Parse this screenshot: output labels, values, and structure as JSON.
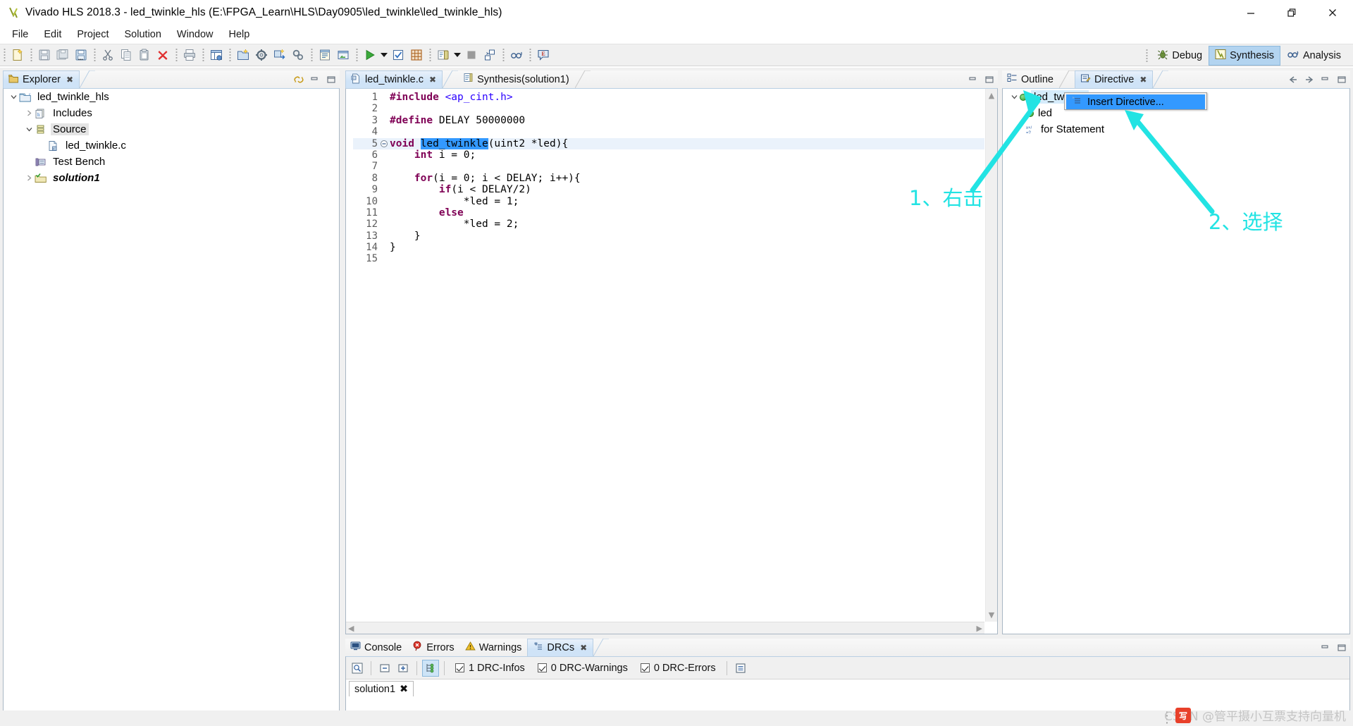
{
  "window": {
    "title": "Vivado HLS 2018.3 - led_twinkle_hls (E:\\FPGA_Learn\\HLS\\Day0905\\led_twinkle\\led_twinkle_hls)",
    "minimize": "—",
    "restore": "❐",
    "close": "✕"
  },
  "menu": {
    "items": [
      {
        "label": "File"
      },
      {
        "label": "Edit"
      },
      {
        "label": "Project"
      },
      {
        "label": "Solution"
      },
      {
        "label": "Window"
      },
      {
        "label": "Help"
      }
    ]
  },
  "toolbar": {
    "icons": [
      "new-file-icon",
      "save-icon",
      "save-all-icon",
      "save-as-icon",
      "cut-icon",
      "copy-icon",
      "paste-icon",
      "delete-icon",
      "print-icon",
      "new-project-icon",
      "new-solution-icon",
      "project-settings-icon",
      "import-icon",
      "solution-settings-icon",
      "report-icon",
      "open-window-icon",
      "run-c-simulation-icon",
      "run-synthesis-icon",
      "run-cosim-icon",
      "export-rtl-icon",
      "open-report-icon",
      "stop-icon",
      "compare-reports-icon",
      "search-icon",
      "annotate-icon"
    ],
    "perspectives": [
      {
        "label": "Debug",
        "icon": "debug-icon",
        "active": false
      },
      {
        "label": "Synthesis",
        "icon": "synthesis-icon",
        "active": true
      },
      {
        "label": "Analysis",
        "icon": "analysis-icon",
        "active": false
      }
    ]
  },
  "explorer": {
    "tab_label": "Explorer",
    "tab_icon": "explorer-icon",
    "tools": [
      "link-with-editor-icon",
      "minimize-icon",
      "maximize-icon"
    ],
    "tree": [
      {
        "label": "led_twinkle_hls",
        "icon": "c-project-icon",
        "arrow": "down",
        "indent": 0,
        "selected": false,
        "style": "normal"
      },
      {
        "label": "Includes",
        "icon": "includes-icon",
        "arrow": "right",
        "indent": 1,
        "selected": false,
        "style": "normal"
      },
      {
        "label": "Source",
        "icon": "source-folder-icon",
        "arrow": "down",
        "indent": 1,
        "selected": true,
        "style": "normal"
      },
      {
        "label": "led_twinkle.c",
        "icon": "c-file-icon",
        "arrow": "none",
        "indent": 2,
        "selected": false,
        "style": "normal"
      },
      {
        "label": "Test Bench",
        "icon": "test-bench-icon",
        "arrow": "none",
        "indent": 1,
        "selected": false,
        "style": "normal"
      },
      {
        "label": "solution1",
        "icon": "solution-folder-icon",
        "arrow": "right",
        "indent": 1,
        "selected": false,
        "style": "bolditalic"
      }
    ]
  },
  "editor": {
    "tabs": [
      {
        "label": "led_twinkle.c",
        "icon": "c-file-icon",
        "active": true,
        "closable": true
      },
      {
        "label": "Synthesis(solution1)",
        "icon": "synthesis-report-icon",
        "active": false,
        "closable": false
      }
    ],
    "tools": [
      "minimize-icon",
      "maximize-icon"
    ],
    "lines": [
      {
        "n": "1",
        "tokens": [
          {
            "t": "#include ",
            "c": "pp"
          },
          {
            "t": "<ap_cint.h>",
            "c": "hdr"
          }
        ],
        "fold": "none",
        "highlight": false
      },
      {
        "n": "2",
        "tokens": [],
        "fold": "none",
        "highlight": false
      },
      {
        "n": "3",
        "tokens": [
          {
            "t": "#define ",
            "c": "pp"
          },
          {
            "t": "DELAY 50000000",
            "c": "plain"
          }
        ],
        "fold": "none",
        "highlight": false
      },
      {
        "n": "4",
        "tokens": [],
        "fold": "none",
        "highlight": false
      },
      {
        "n": "5",
        "tokens": [
          {
            "t": "void ",
            "c": "kw"
          },
          {
            "t": "led_twinkle",
            "c": "sel-tok"
          },
          {
            "t": "(uint2 *led){",
            "c": "plain"
          }
        ],
        "fold": "collapse",
        "highlight": true
      },
      {
        "n": "6",
        "tokens": [
          {
            "t": "    ",
            "c": "plain"
          },
          {
            "t": "int ",
            "c": "kw"
          },
          {
            "t": "i = 0;",
            "c": "plain"
          }
        ],
        "fold": "none",
        "highlight": false
      },
      {
        "n": "7",
        "tokens": [],
        "fold": "none",
        "highlight": false
      },
      {
        "n": "8",
        "tokens": [
          {
            "t": "    ",
            "c": "plain"
          },
          {
            "t": "for",
            "c": "kw"
          },
          {
            "t": "(i = 0; i < DELAY; i++){",
            "c": "plain"
          }
        ],
        "fold": "none",
        "highlight": false
      },
      {
        "n": "9",
        "tokens": [
          {
            "t": "        ",
            "c": "plain"
          },
          {
            "t": "if",
            "c": "kw"
          },
          {
            "t": "(i < DELAY/2)",
            "c": "plain"
          }
        ],
        "fold": "none",
        "highlight": false
      },
      {
        "n": "10",
        "tokens": [
          {
            "t": "            *led = 1;",
            "c": "plain"
          }
        ],
        "fold": "none",
        "highlight": false
      },
      {
        "n": "11",
        "tokens": [
          {
            "t": "        ",
            "c": "plain"
          },
          {
            "t": "else",
            "c": "kw"
          }
        ],
        "fold": "none",
        "highlight": false
      },
      {
        "n": "12",
        "tokens": [
          {
            "t": "            *led = 2;",
            "c": "plain"
          }
        ],
        "fold": "none",
        "highlight": false
      },
      {
        "n": "13",
        "tokens": [
          {
            "t": "    }",
            "c": "plain"
          }
        ],
        "fold": "none",
        "highlight": false
      },
      {
        "n": "14",
        "tokens": [
          {
            "t": "}",
            "c": "plain"
          }
        ],
        "fold": "none",
        "highlight": false
      },
      {
        "n": "15",
        "tokens": [],
        "fold": "none",
        "highlight": false
      }
    ]
  },
  "directive": {
    "tabs": [
      {
        "label": "Outline",
        "icon": "outline-icon",
        "active": false,
        "closable": false
      },
      {
        "label": "Directive",
        "icon": "directive-icon",
        "active": true,
        "closable": true
      }
    ],
    "tools": [
      "back-arrow-icon",
      "forward-arrow-icon",
      "minimize-icon",
      "maximize-icon"
    ],
    "tree": [
      {
        "label": "led_twinkle",
        "icon": "green-dot-icon",
        "arrow": "down",
        "indent": 0,
        "selected": true
      },
      {
        "label": "led",
        "icon": "green-dot-icon",
        "arrow": "none",
        "indent": 1,
        "selected": false
      },
      {
        "label": "for Statement",
        "icon": "loop-icon",
        "arrow": "none",
        "indent": 1,
        "selected": false
      }
    ],
    "context_menu": {
      "items": [
        {
          "label": "Insert Directive...",
          "icon": "insert-directive-icon",
          "highlighted": true
        }
      ]
    }
  },
  "console": {
    "tabs": [
      {
        "label": "Console",
        "icon": "console-icon",
        "active": false,
        "closable": false
      },
      {
        "label": "Errors",
        "icon": "errors-icon",
        "active": false,
        "closable": false
      },
      {
        "label": "Warnings",
        "icon": "warnings-icon",
        "active": false,
        "closable": false
      },
      {
        "label": "DRCs",
        "icon": "drcs-icon",
        "active": true,
        "closable": true
      }
    ],
    "tools": [
      "minimize-icon",
      "maximize-icon"
    ],
    "drc_toolbar": {
      "buttons": [
        "search-drc-icon",
        "collapse-all-icon",
        "expand-all-icon",
        "group-by-icon",
        "details-icon"
      ],
      "checks": [
        {
          "label": "1 DRC-Infos",
          "checked": true
        },
        {
          "label": "0 DRC-Warnings",
          "checked": true
        },
        {
          "label": "0 DRC-Errors",
          "checked": true
        }
      ]
    },
    "subtabs": [
      {
        "label": "solution1",
        "closable": true
      }
    ]
  },
  "annotations": [
    {
      "id": "anno1",
      "text": "1、右击",
      "color": "#22e3e3"
    },
    {
      "id": "anno2",
      "text": "2、选择",
      "color": "#22e3e3"
    }
  ],
  "watermark": {
    "text": "CSDN @管平摄小互票支持向量机",
    "badge": "写"
  },
  "colors": {
    "accent": "#3399ff",
    "annotation": "#22e3e3",
    "tab_active": "#cfe3f7",
    "selection": "#e4e4e4",
    "keyword": "#7f0055",
    "header_string": "#2a00ff",
    "panel_border": "#a9b7c4"
  }
}
